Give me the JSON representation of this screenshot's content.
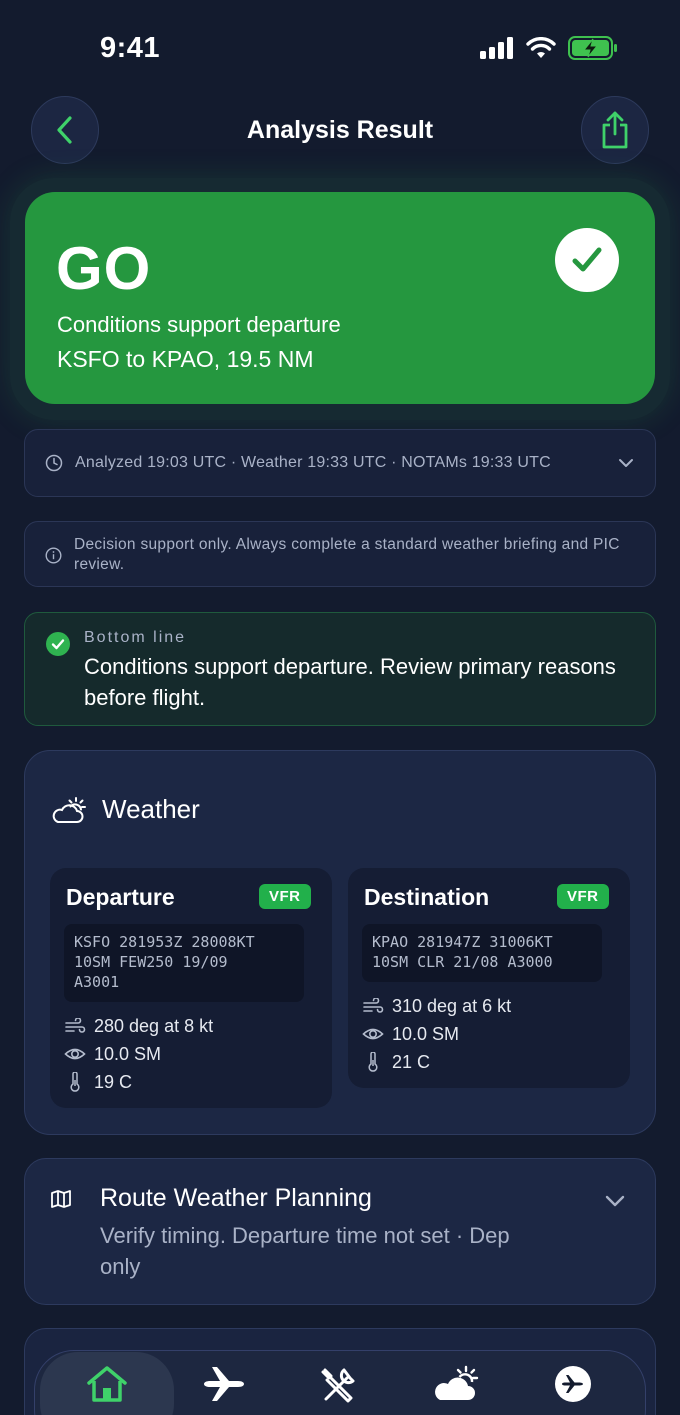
{
  "status_bar": {
    "time": "9:41"
  },
  "header": {
    "title": "Analysis Result"
  },
  "decision": {
    "verdict": "GO",
    "summary": "Conditions support departure",
    "route": "KSFO to KPAO, 19.5 NM"
  },
  "timestamps": {
    "text": "Analyzed 19:03 UTC · Weather 19:33 UTC · NOTAMs 19:33 UTC"
  },
  "disclaimer": {
    "text": "Decision support only. Always complete a standard weather briefing and PIC review."
  },
  "bottom_line": {
    "label": "Bottom line",
    "text": "Conditions support departure. Review primary reasons before flight."
  },
  "weather": {
    "title": "Weather",
    "departure": {
      "label": "Departure",
      "category": "VFR",
      "metar": "KSFO 281953Z 28008KT\n10SM FEW250 19/09\nA3001",
      "wind": "280 deg at 8 kt",
      "visibility": "10.0 SM",
      "temperature": "19 C"
    },
    "destination": {
      "label": "Destination",
      "category": "VFR",
      "metar": "KPAO 281947Z 31006KT\n10SM CLR 21/08 A3000",
      "wind": "310 deg at 6 kt",
      "visibility": "10.0 SM",
      "temperature": "21 C"
    }
  },
  "route_planning": {
    "title": "Route Weather Planning",
    "subtitle": "Verify timing. Departure time not set · Dep only"
  },
  "colors": {
    "go_green": "#25973f",
    "vfr_green": "#22b04b",
    "background": "#131b2e"
  },
  "tabs": [
    {
      "icon": "home-icon",
      "active": true
    },
    {
      "icon": "airplane-icon",
      "active": false
    },
    {
      "icon": "tools-icon",
      "active": false
    },
    {
      "icon": "weather-icon",
      "active": false
    },
    {
      "icon": "aircraft-icon",
      "active": false
    }
  ]
}
